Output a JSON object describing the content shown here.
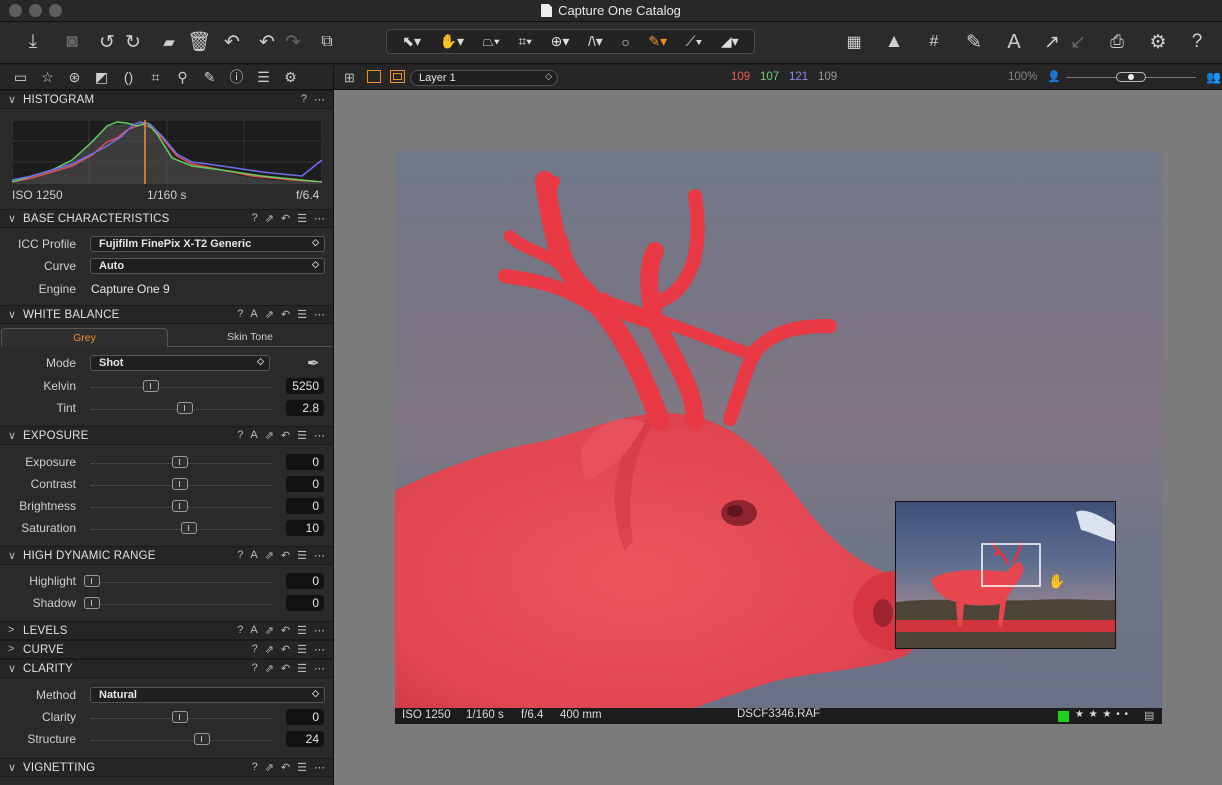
{
  "window": {
    "title": "Capture One Catalog"
  },
  "toolbar": {
    "left_icons": [
      "import-icon",
      "camera-icon",
      "rotate-left-icon",
      "rotate-right-icon",
      "move-to-folder-icon",
      "trash-icon",
      "undo-left-icon",
      "undo-icon",
      "redo-icon",
      "copy-settings-icon"
    ],
    "cursor_tools": [
      "select-cursor-icon",
      "pan-icon",
      "straighten-icon",
      "crop-icon",
      "keystone-icon",
      "guides-icon",
      "circle-mask-icon",
      "brush-icon",
      "color-picker-icon",
      "eraser-icon"
    ],
    "right_icons": [
      "grid-view-icon",
      "warning-icon",
      "grid-overlay-icon",
      "draw-icon",
      "text-annotation-icon",
      "apply-arrow-icon",
      "copy-arrow-icon",
      "print-icon",
      "settings-icon",
      "help-icon"
    ]
  },
  "tool_tabs": [
    "library-icon",
    "favorites-star-icon",
    "color-icon",
    "exposure-icon",
    "lens-icon",
    "crop-tool-icon",
    "details-icon",
    "adjustments-icon",
    "metadata-icon",
    "output-icon",
    "settings-tab-icon"
  ],
  "histogram": {
    "title": "HISTOGRAM",
    "iso": "ISO 1250",
    "shutter": "1/160 s",
    "aperture": "f/6.4"
  },
  "base": {
    "title": "BASE CHARACTERISTICS",
    "icc_label": "ICC Profile",
    "icc_value": "Fujifilm FinePix X-T2 Generic",
    "curve_label": "Curve",
    "curve_value": "Auto",
    "engine_label": "Engine",
    "engine_value": "Capture One 9"
  },
  "wb": {
    "title": "WHITE BALANCE",
    "tab_grey": "Grey",
    "tab_skin": "Skin Tone",
    "mode_label": "Mode",
    "mode_value": "Shot",
    "kelvin_label": "Kelvin",
    "kelvin_value": "5250",
    "tint_label": "Tint",
    "tint_value": "2.8"
  },
  "exposure": {
    "title": "EXPOSURE",
    "rows": [
      {
        "label": "Exposure",
        "value": "0"
      },
      {
        "label": "Contrast",
        "value": "0"
      },
      {
        "label": "Brightness",
        "value": "0"
      },
      {
        "label": "Saturation",
        "value": "10"
      }
    ]
  },
  "hdr": {
    "title": "HIGH DYNAMIC RANGE",
    "rows": [
      {
        "label": "Highlight",
        "value": "0"
      },
      {
        "label": "Shadow",
        "value": "0"
      }
    ]
  },
  "levels": {
    "title": "LEVELS"
  },
  "curve": {
    "title": "CURVE"
  },
  "clarity": {
    "title": "CLARITY",
    "method_label": "Method",
    "method_value": "Natural",
    "rows": [
      {
        "label": "Clarity",
        "value": "0"
      },
      {
        "label": "Structure",
        "value": "24"
      }
    ]
  },
  "vignetting": {
    "title": "VIGNETTING"
  },
  "viewer": {
    "layer": "Layer 1",
    "rgb": {
      "r": "109",
      "g": "107",
      "b": "121",
      "l": "109"
    },
    "zoom": "100%"
  },
  "image_info": {
    "iso": "ISO 1250",
    "shutter": "1/160 s",
    "aperture": "f/6.4",
    "focal": "400 mm",
    "filename": "DSCF3346.RAF",
    "rating_stars": "★ ★ ★ • •"
  },
  "colors": {
    "mask": "#e8333e",
    "accent": "#f0902a",
    "r": "#e06060",
    "g": "#6fd06f",
    "b": "#8a8af0"
  }
}
